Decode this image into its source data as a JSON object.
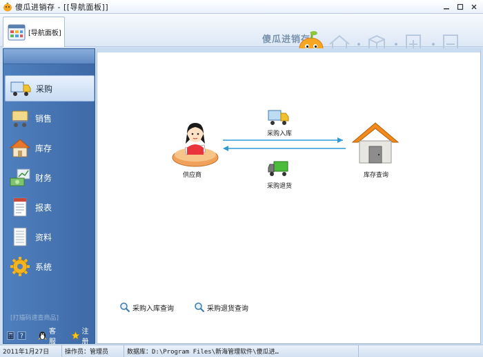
{
  "window": {
    "title": "傻瓜进销存 - [[导航面板]]",
    "controls": [
      "minimize-icon",
      "maximize-icon",
      "close-icon"
    ]
  },
  "toolbar": {
    "tab_label": "[导航面板]",
    "brand_text": "傻瓜进销存",
    "tools": [
      "home-icon",
      "cube-icon",
      "add-document-icon",
      "remove-document-icon"
    ]
  },
  "sidebar": {
    "items": [
      {
        "label": "采购",
        "icon": "truck-icon",
        "active": true
      },
      {
        "label": "销售",
        "icon": "cart-icon",
        "active": false
      },
      {
        "label": "库存",
        "icon": "house-icon",
        "active": false
      },
      {
        "label": "财务",
        "icon": "money-chart-icon",
        "active": false
      },
      {
        "label": "报表",
        "icon": "report-icon",
        "active": false
      },
      {
        "label": "资料",
        "icon": "document-icon",
        "active": false
      },
      {
        "label": "系统",
        "icon": "gear-icon",
        "active": false
      }
    ],
    "search_hint": "[打描码速查商品]",
    "bottom": {
      "customer_service": "客服",
      "register": "注册"
    }
  },
  "flow": {
    "supplier": "供应商",
    "purchase_in": "采购入库",
    "purchase_return": "采购退货",
    "inventory_query": "库存查询"
  },
  "queries": {
    "purchase_in_query": "采购入库查询",
    "purchase_return_query": "采购退货查询"
  },
  "status": {
    "date": "2011年1月27日",
    "operator": "操作员：管理员",
    "database": "数据库：D:\\Program Files\\新海管理软件\\傻瓜进…"
  },
  "colors": {
    "sidebar": "#3e6aa7",
    "accent": "#2e9ad8",
    "window_bg": "#cfe0f4"
  }
}
